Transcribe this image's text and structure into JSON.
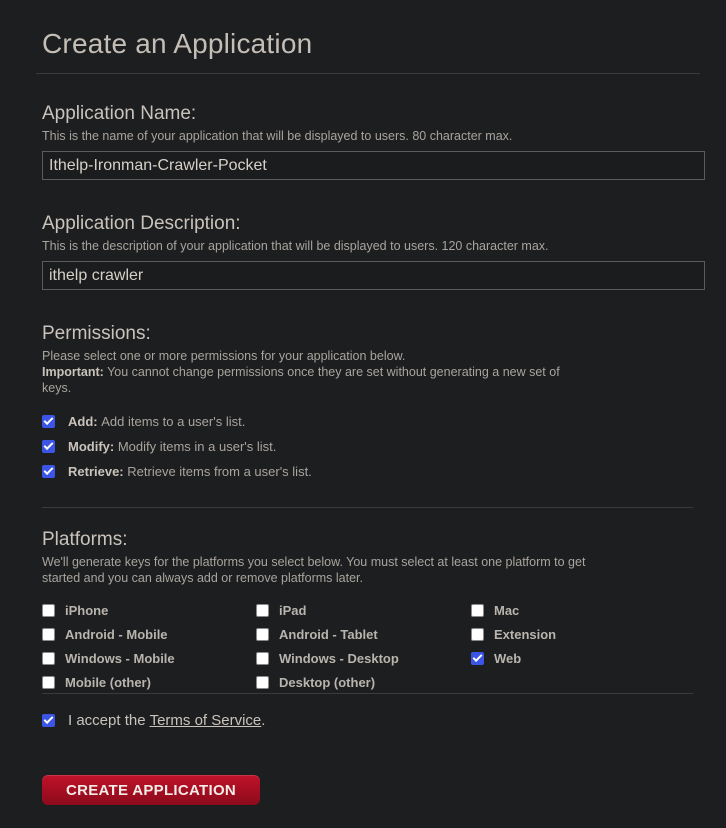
{
  "page_title": "Create an Application",
  "name_section": {
    "title": "Application Name:",
    "help": "This is the name of your application that will be displayed to users. 80 character max.",
    "value": "Ithelp-Ironman-Crawler-Pocket"
  },
  "description_section": {
    "title": "Application Description:",
    "help": "This is the description of your application that will be displayed to users. 120 character max.",
    "value": "ithelp crawler"
  },
  "permissions": {
    "title": "Permissions:",
    "help": "Please select one or more permissions for your application below.",
    "important_label": "Important:",
    "important_text": "You cannot change permissions once they are set without generating a new set of keys.",
    "items": [
      {
        "label": "Add:",
        "desc": "Add items to a user's list.",
        "checked": true
      },
      {
        "label": "Modify:",
        "desc": "Modify items in a user's list.",
        "checked": true
      },
      {
        "label": "Retrieve:",
        "desc": "Retrieve items from a user's list.",
        "checked": true
      }
    ]
  },
  "platforms": {
    "title": "Platforms:",
    "help": "We'll generate keys for the platforms you select below. You must select at least one platform to get started and you can always add or remove platforms later.",
    "items": [
      {
        "label": "iPhone",
        "checked": false
      },
      {
        "label": "iPad",
        "checked": false
      },
      {
        "label": "Mac",
        "checked": false
      },
      {
        "label": "Android - Mobile",
        "checked": false
      },
      {
        "label": "Android - Tablet",
        "checked": false
      },
      {
        "label": "Extension",
        "checked": false
      },
      {
        "label": "Windows - Mobile",
        "checked": false
      },
      {
        "label": "Windows - Desktop",
        "checked": false
      },
      {
        "label": "Web",
        "checked": true
      },
      {
        "label": "Mobile (other)",
        "checked": false
      },
      {
        "label": "Desktop (other)",
        "checked": false
      }
    ]
  },
  "terms": {
    "prefix": "I accept the",
    "link": "Terms of Service",
    "suffix": ".",
    "checked": true
  },
  "create_button": "CREATE APPLICATION",
  "colors": {
    "background": "#1d1e20",
    "accent_button": "#a80f23",
    "checkbox_on": "#3b55e6"
  }
}
